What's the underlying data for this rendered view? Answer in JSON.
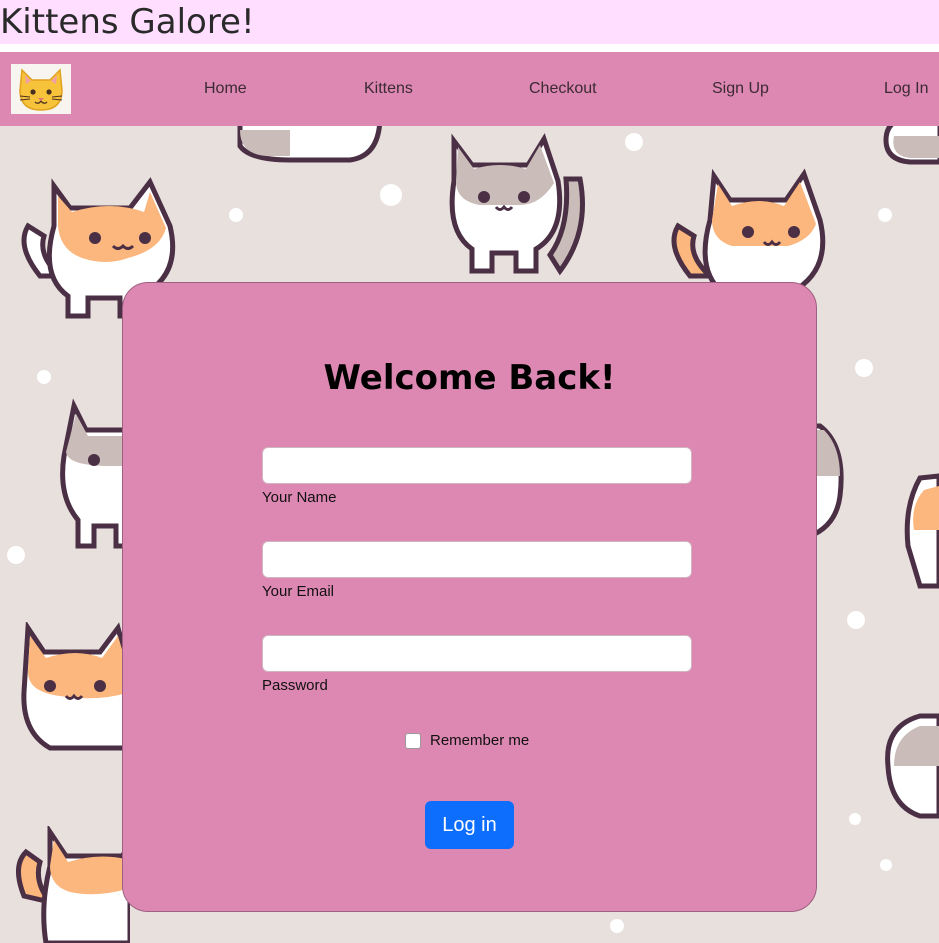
{
  "site": {
    "title": "Kittens Galore!"
  },
  "nav": {
    "logo_icon": "cat-face-icon",
    "links": [
      {
        "label": "Home"
      },
      {
        "label": "Kittens"
      },
      {
        "label": "Checkout"
      },
      {
        "label": "Sign Up"
      },
      {
        "label": "Log In"
      }
    ]
  },
  "login": {
    "heading": "Welcome Back!",
    "fields": [
      {
        "label": "Your Name",
        "value": ""
      },
      {
        "label": "Your Email",
        "value": ""
      },
      {
        "label": "Password",
        "value": ""
      }
    ],
    "remember_label": "Remember me",
    "remember_checked": false,
    "submit_label": "Log in"
  },
  "colors": {
    "header_bg": "#ffdeff",
    "nav_bg": "#dd88b2",
    "card_bg": "#dd88b2",
    "button_bg": "#0d6efd",
    "page_bg": "#e8e0dc"
  }
}
